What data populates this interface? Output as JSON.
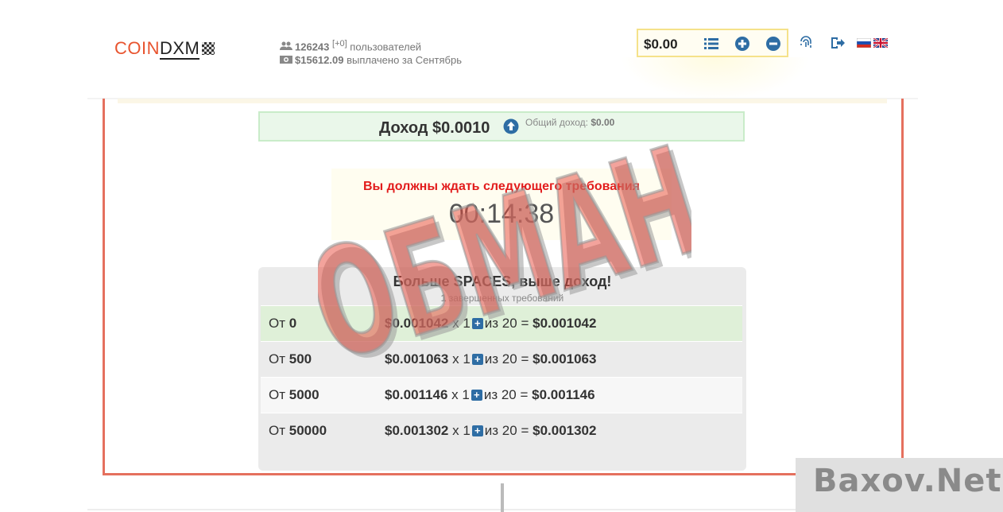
{
  "logo": {
    "part1": "COIN",
    "part2": "DXM"
  },
  "stats": {
    "users_count": "126243",
    "users_delta": "[+0]",
    "users_label": "пользователей",
    "paid_amount": "$15612.09",
    "paid_label": "выплачено за Сентябрь"
  },
  "balance": {
    "amount": "$0.00"
  },
  "income": {
    "label": "Доход $0.0010",
    "total_label": "Общий доход:",
    "total_value": "$0.00"
  },
  "wait": {
    "message": "Вы должны ждать следующего требования",
    "timer": "00:14:38"
  },
  "spaces": {
    "title": "Больше SPACES, выше доход!",
    "completed_count": "1",
    "completed_label": "завершенных требований",
    "rows": [
      {
        "from_label": "От",
        "from_value": "0",
        "rate": "$0.001042",
        "mult": "x 1",
        "of": "из 20 =",
        "total": "$0.001042",
        "bg": "#dff0d8"
      },
      {
        "from_label": "От",
        "from_value": "500",
        "rate": "$0.001063",
        "mult": "x 1",
        "of": "из 20 =",
        "total": "$0.001063",
        "bg": "#ebebeb"
      },
      {
        "from_label": "От",
        "from_value": "5000",
        "rate": "$0.001146",
        "mult": "x 1",
        "of": "из 20 =",
        "total": "$0.001146",
        "bg": "#f7f7f7"
      },
      {
        "from_label": "От",
        "from_value": "50000",
        "rate": "$0.001302",
        "mult": "x 1",
        "of": "из 20 =",
        "total": "$0.001302",
        "bg": "#ebebeb"
      }
    ]
  },
  "stamp": {
    "text": "ОБМАН",
    "color": "#e8483a"
  },
  "watermark": {
    "text": "Baxov.Net"
  },
  "colors": {
    "accent_blue": "#2e6da4",
    "logo_orange": "#e8542f",
    "alert_red": "#e21c1c",
    "frame": "#e5705e"
  }
}
